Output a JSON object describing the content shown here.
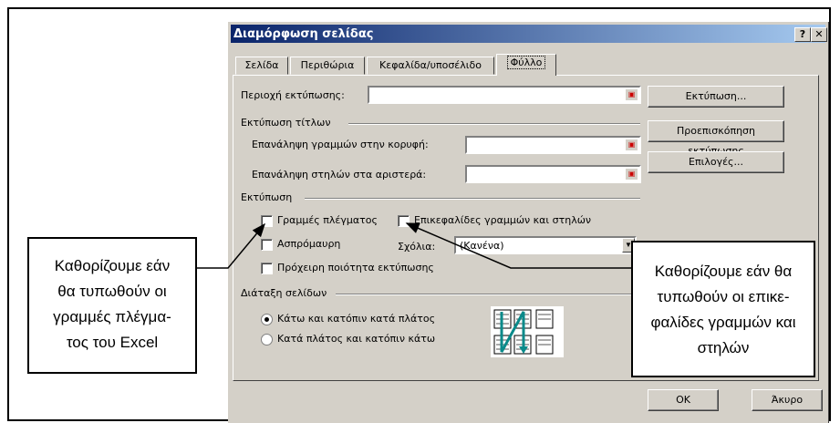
{
  "dialog": {
    "title": "Διαμόρφωση σελίδας",
    "help_label": "?",
    "close_label": "✕",
    "tabs": [
      {
        "label": "Σελίδα"
      },
      {
        "label": "Περιθώρια"
      },
      {
        "label": "Κεφαλίδα/υποσέλιδο"
      },
      {
        "label": "Φύλλο"
      }
    ],
    "print_area": {
      "label": "Περιοχή εκτύπωσης:",
      "value": ""
    },
    "print_titles": {
      "group_label": "Εκτύπωση τίτλων",
      "rows_label": "Επανάληψη γραμμών στην κορυφή:",
      "rows_value": "",
      "cols_label": "Επανάληψη στηλών στα αριστερά:",
      "cols_value": ""
    },
    "print": {
      "group_label": "Εκτύπωση",
      "gridlines_label": "Γραμμές πλέγματος",
      "gridlines_checked": false,
      "headings_label": "Επικεφαλίδες γραμμών και στηλών",
      "headings_checked": false,
      "bw_label": "Ασπρόμαυρη",
      "bw_checked": false,
      "comments_label": "Σχόλια:",
      "comments_value": "(Κανένα)",
      "draft_label": "Πρόχειρη ποιότητα εκτύπωσης",
      "draft_checked": false
    },
    "page_order": {
      "group_label": "Διάταξη σελίδων",
      "down_then_over": "Κάτω και κατόπιν κατά πλάτος",
      "over_then_down": "Κατά πλάτος και κατόπιν κάτω",
      "selected": "down_then_over"
    },
    "buttons": {
      "print": "Εκτύπωση...",
      "preview": "Προεπισκόπηση εκτύπωσης",
      "options": "Επιλογές...",
      "ok": "OK",
      "cancel": "Άκυρο"
    },
    "colors": {
      "face": "#d4d0c8",
      "title_start": "#0a246a",
      "title_end": "#a6caf0"
    }
  },
  "callouts": {
    "gridlines": [
      "Καθορίζουμε εάν",
      "θα τυπωθούν οι",
      "γραμμές πλέγμα-",
      "τος του Excel"
    ],
    "headings": [
      "Καθορίζουμε εάν θα",
      "τυπωθούν οι επικε-",
      "φαλίδες γραμμών και",
      "στηλών"
    ]
  }
}
